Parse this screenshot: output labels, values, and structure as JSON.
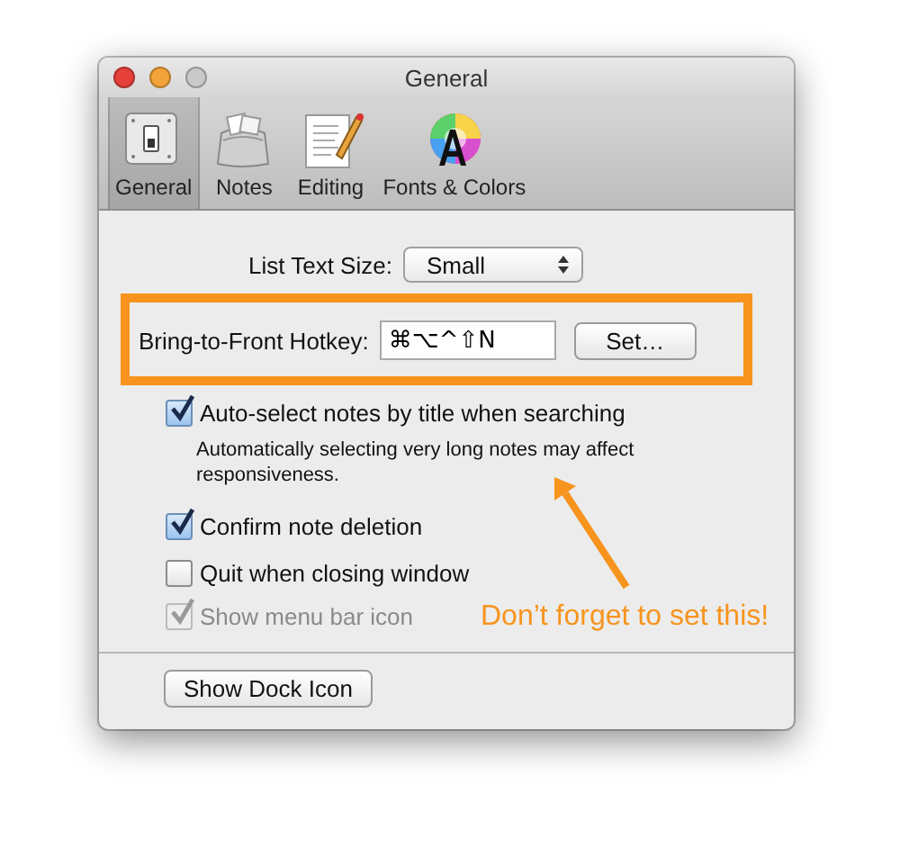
{
  "window": {
    "title": "General"
  },
  "toolbar": [
    {
      "label": "General",
      "kind": "switch",
      "selected": true
    },
    {
      "label": "Notes",
      "kind": "bag",
      "selected": false
    },
    {
      "label": "Editing",
      "kind": "document",
      "selected": false
    },
    {
      "label": "Fonts & Colors",
      "kind": "color-wheel",
      "selected": false
    }
  ],
  "list_text_size": {
    "label": "List Text Size:",
    "value": "Small"
  },
  "hotkey": {
    "label": "Bring-to-Front Hotkey:",
    "value": "⌘⌥^⇧N",
    "button": "Set…"
  },
  "options": [
    {
      "label": "Auto-select notes by title when searching",
      "checked": true,
      "disabled": false,
      "note": "Automatically selecting very long notes may affect responsiveness."
    },
    {
      "label": "Confirm note deletion",
      "checked": true,
      "disabled": false
    },
    {
      "label": "Quit when closing window",
      "checked": false,
      "disabled": false
    },
    {
      "label": "Show menu bar icon",
      "checked": true,
      "disabled": true
    }
  ],
  "footer_button": "Show Dock Icon",
  "annotation": {
    "text": "Don’t forget to set this!"
  }
}
